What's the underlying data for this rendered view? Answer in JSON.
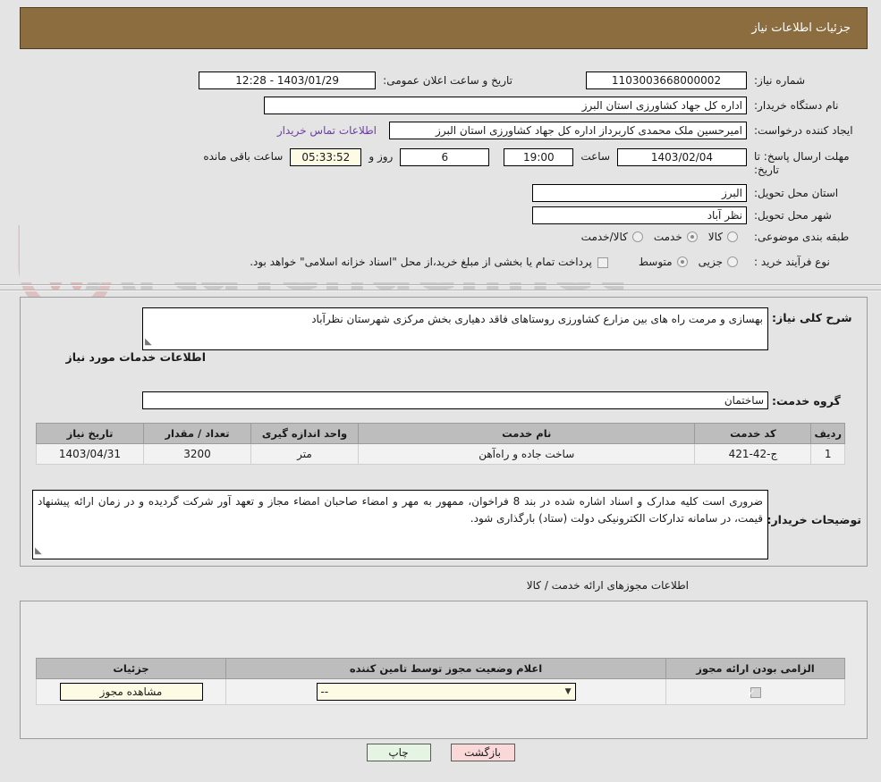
{
  "header": {
    "title": "جزئیات اطلاعات نیاز"
  },
  "watermark": {
    "text": "ArtaTender.net"
  },
  "colors": {
    "header_brown": "#8c6d3f",
    "link_purple": "#6b3fa0",
    "cream_field": "#fdfbe4",
    "back_button": "#fbd8d8",
    "print_button": "#e6f5e3",
    "table_header": "#bdbdbd",
    "page_background": "#e4e4e4"
  },
  "fields": {
    "need_number_label": "شماره نیاز:",
    "need_number_value": "1103003668000002",
    "announce_datetime_label": "تاریخ و ساعت اعلان عمومی:",
    "announce_datetime_value": "1403/01/29 - 12:28",
    "buyer_org_label": "نام دستگاه خریدار:",
    "buyer_org_value": "اداره کل جهاد کشاورزی استان البرز",
    "creator_label": "ایجاد کننده درخواست:",
    "creator_value": "امیرحسین ملک محمدی کاربرداز اداره کل جهاد کشاورزی استان البرز",
    "contact_link": "اطلاعات تماس خریدار",
    "deadline_label": "مهلت ارسال پاسخ: تا تاریخ:",
    "deadline_date": "1403/02/04",
    "hour_label": "ساعت",
    "deadline_time": "19:00",
    "days_remaining": "6",
    "days_and_label": "روز و",
    "time_remaining": "05:33:52",
    "hours_remaining_label": "ساعت باقی مانده",
    "province_label": "استان محل تحویل:",
    "province_value": "البرز",
    "city_label": "شهر محل تحویل:",
    "city_value": "نظر آباد"
  },
  "classification": {
    "label": "طبقه بندی موضوعی:",
    "options": [
      {
        "label": "کالا",
        "selected": false
      },
      {
        "label": "خدمت",
        "selected": true
      },
      {
        "label": "کالا/خدمت",
        "selected": false
      }
    ]
  },
  "purchase_type": {
    "label": "نوع فرآیند خرید :",
    "options": [
      {
        "label": "جزیی",
        "selected": false
      },
      {
        "label": "متوسط",
        "selected": true
      }
    ],
    "checkbox_label": "پرداخت تمام یا بخشی از مبلغ خرید،از محل \"اسناد خزانه اسلامی\" خواهد بود.",
    "checkbox_checked": false
  },
  "description": {
    "label": "شرح کلی نیاز:",
    "value": "بهسازی و مرمت راه های بین مزارع کشاورزی روستاهای فاقد دهیاری بخش مرکزی شهرستان نظرآباد"
  },
  "services_section": {
    "title": "اطلاعات خدمات مورد نیاز",
    "group_label": "گروه خدمت:",
    "group_value": "ساختمان"
  },
  "services_table": {
    "columns": [
      "ردیف",
      "کد خدمت",
      "نام خدمت",
      "واحد اندازه گیری",
      "تعداد / مقدار",
      "تاریخ نیاز"
    ],
    "rows": [
      {
        "row_no": "1",
        "service_code": "ج-42-421",
        "service_name": "ساخت جاده و راه‌آهن",
        "unit": "متر",
        "quantity": "3200",
        "need_date": "1403/04/31"
      }
    ]
  },
  "buyer_notes": {
    "label": "توضیحات خریدار:",
    "value": "ضروری است کلیه مدارک و اسناد اشاره شده در بند 8 فراخوان، ممهور به مهر و امضاء صاحبان امضاء مجاز و تعهد آور شرکت گردیده و در زمان ارائه پیشنهاد قیمت، در سامانه تدارکات الکترونیکی دولت (ستاد) بارگذاری شود."
  },
  "permits_section": {
    "title": "اطلاعات مجوزهای ارائه خدمت / کالا",
    "columns": [
      "الزامی بودن ارائه مجوز",
      "اعلام وضعیت مجوز توسط تامین کننده",
      "جزئیات"
    ],
    "rows": [
      {
        "required": true,
        "status_value": "--",
        "detail_button": "مشاهده مجوز"
      }
    ]
  },
  "footer": {
    "back_label": "بازگشت",
    "print_label": "چاپ"
  }
}
